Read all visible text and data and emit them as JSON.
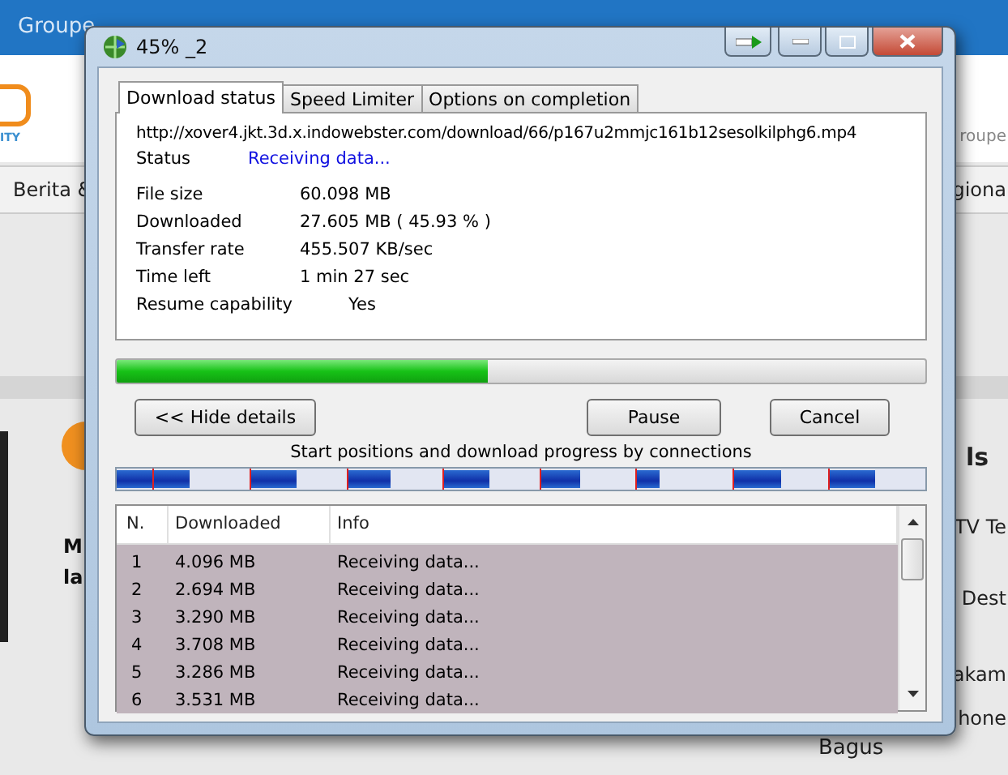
{
  "background_page": {
    "top_bar": "Groupe",
    "logo_text": "ITY",
    "header_right": "roupe",
    "nav_left": "Berita &",
    "nav_right": "giona",
    "left_heading_lines": [
      "M",
      "la"
    ],
    "right_heading": "ls",
    "right_items": [
      "TV Te",
      "Dest",
      "akam",
      "hone"
    ],
    "bottom_text": "Bagus"
  },
  "window": {
    "title": "45% _2"
  },
  "tabs": [
    {
      "label": "Download status",
      "selected": true
    },
    {
      "label": "Speed Limiter",
      "selected": false
    },
    {
      "label": "Options on completion",
      "selected": false
    }
  ],
  "url": "http://xover4.jkt.3d.x.indowebster.com/download/66/p167u2mmjc161b12sesolkilphg6.mp4",
  "status": {
    "label": "Status",
    "value": "Receiving data..."
  },
  "details": [
    {
      "label": "File size",
      "value": "60.098  MB"
    },
    {
      "label": "Downloaded",
      "value": "27.605  MB  ( 45.93 % )"
    },
    {
      "label": "Transfer rate",
      "value": "455.507  KB/sec"
    },
    {
      "label": "Time left",
      "value": "1 min 27 sec"
    },
    {
      "label": "Resume capability",
      "value": "Yes",
      "kind": "indented"
    }
  ],
  "progress": {
    "level": 0.4593
  },
  "buttons": {
    "details": "<< Hide details",
    "pause": "Pause",
    "cancel": "Cancel"
  },
  "connections_caption": "Start positions and download progress by connections",
  "connection_segments": [
    {
      "level": 1
    },
    {
      "level": 0.37
    },
    {
      "level": 0.47
    },
    {
      "level": 0.45
    },
    {
      "level": 0.47
    },
    {
      "level": 0.42
    },
    {
      "level": 0.23
    },
    {
      "level": 0.5
    },
    {
      "level": 0.47
    }
  ],
  "table": {
    "columns": [
      "N.",
      "Downloaded",
      "Info"
    ],
    "rows": [
      [
        "1",
        "4.096  MB",
        "Receiving data..."
      ],
      [
        "2",
        "2.694  MB",
        "Receiving data..."
      ],
      [
        "3",
        "3.290  MB",
        "Receiving data..."
      ],
      [
        "4",
        "3.708  MB",
        "Receiving data..."
      ],
      [
        "5",
        "3.286  MB",
        "Receiving data..."
      ],
      [
        "6",
        "3.531  MB",
        "Receiving data..."
      ]
    ]
  }
}
